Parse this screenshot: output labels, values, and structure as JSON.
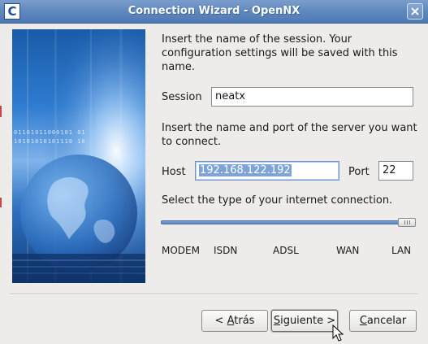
{
  "window": {
    "title": "Connection Wizard - OpenNX",
    "app_icon_glyph": "C"
  },
  "intro": {
    "text": "Insert the name of the session. Your configuration settings will be saved with this name."
  },
  "session": {
    "label": "Session",
    "value": "neatx"
  },
  "server_intro": {
    "text": "Insert the name and port of the server you want to connect."
  },
  "host": {
    "label": "Host",
    "value": "192.168.122.192"
  },
  "port": {
    "label": "Port",
    "value": "22"
  },
  "connection": {
    "prompt": "Select the type of your internet connection.",
    "options": [
      "MODEM",
      "ISDN",
      "ADSL",
      "WAN",
      "LAN"
    ],
    "selected": "LAN"
  },
  "banner": {
    "binary_line_1": "01101011000101 01",
    "binary_line_2": "10101010101110 10"
  },
  "buttons": {
    "back_prefix": "< ",
    "back_mnemonic": "A",
    "back_rest": "trás",
    "next_mnemonic": "S",
    "next_rest": "iguiente",
    "next_suffix": " >",
    "cancel_mnemonic": "C",
    "cancel_rest": "ancelar"
  },
  "colors": {
    "titlebar": "#5d86bd",
    "banner_blue": "#2e7bd0",
    "selection": "#7ea3d6"
  },
  "icons": [
    "app-logo-icon",
    "close-icon",
    "globe-illustration",
    "mouse-pointer-icon"
  ]
}
